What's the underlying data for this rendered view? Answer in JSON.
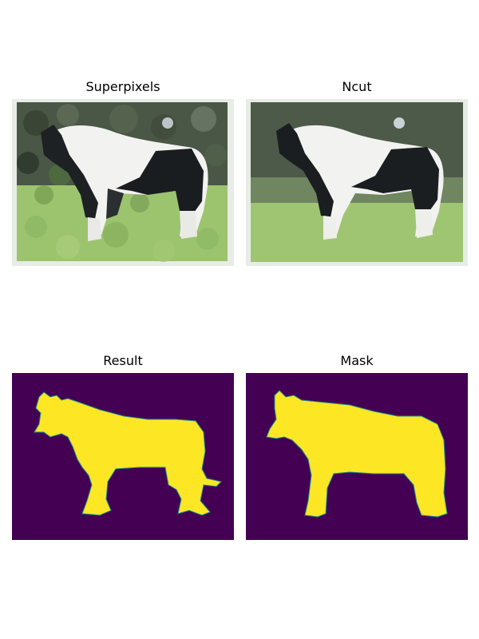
{
  "panels": [
    {
      "title": "Superpixels"
    },
    {
      "title": "Ncut"
    },
    {
      "title": "Result"
    },
    {
      "title": "Mask"
    }
  ],
  "colors": {
    "mask_background": "#440154",
    "mask_foreground": "#fde725",
    "mask_edge": "#21918c",
    "grass": "#9cc46e",
    "trees": "#4c5a44",
    "horse_dark": "#1a1d1f",
    "horse_light": "#f2f2f0"
  }
}
